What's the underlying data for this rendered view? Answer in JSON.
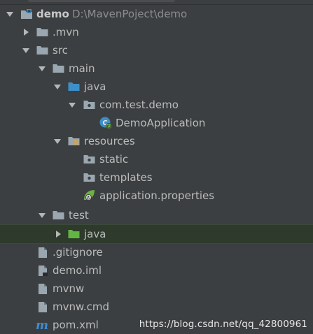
{
  "project_tree": {
    "root": {
      "label": "demo",
      "path": "D:\\MavenPoject\\demo"
    },
    "items": [
      {
        "label": ".mvn"
      },
      {
        "label": "src"
      },
      {
        "label": "main"
      },
      {
        "label": "java"
      },
      {
        "label": "com.test.demo"
      },
      {
        "label": "DemoApplication"
      },
      {
        "label": "resources"
      },
      {
        "label": "static"
      },
      {
        "label": "templates"
      },
      {
        "label": "application.properties"
      },
      {
        "label": "test"
      },
      {
        "label": "java"
      },
      {
        "label": ".gitignore"
      },
      {
        "label": "demo.iml"
      },
      {
        "label": "mvnw"
      },
      {
        "label": "mvnw.cmd"
      },
      {
        "label": "pom.xml"
      }
    ],
    "selected_item": "java",
    "icons": {
      "root": "module-folder-icon",
      "folder": "folder-icon",
      "source_root": "source-root-folder-icon",
      "test_root": "test-root-folder-icon",
      "package": "package-icon",
      "resources_root": "resources-root-folder-icon",
      "spring_boot_class": "spring-boot-application-class-icon",
      "spring_config": "spring-properties-file-icon",
      "text_file": "text-file-icon",
      "iml_file": "iml-file-icon",
      "maven_pom": "maven-icon"
    }
  },
  "watermark": {
    "text": "https://blog.csdn.net/qq_42800961"
  },
  "colors": {
    "background": "#3c3f41",
    "text": "#bbbbbb",
    "path_text": "#8c8c8c",
    "selection": "#2d3a2c",
    "folder_gray": "#9aa7b0",
    "source_blue": "#3d8fc9",
    "test_green": "#62b543",
    "spring_green": "#6db33f",
    "maven_blue": "#3b8ed9"
  }
}
